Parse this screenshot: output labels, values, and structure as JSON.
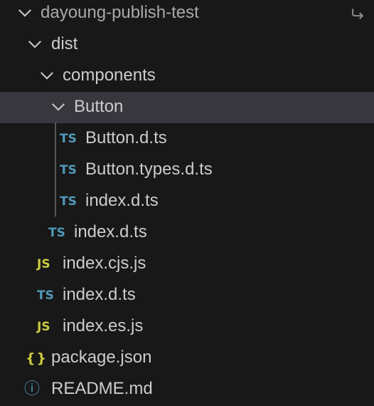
{
  "explorer": {
    "root": {
      "label": "dayoung-publish-test",
      "expanded": true
    },
    "items": [
      {
        "label": "dist",
        "type": "folder",
        "expanded": true
      },
      {
        "label": "components",
        "type": "folder",
        "expanded": true
      },
      {
        "label": "Button",
        "type": "folder",
        "expanded": true,
        "selected": true
      },
      {
        "label": "Button.d.ts",
        "type": "ts",
        "icon": "TS"
      },
      {
        "label": "Button.types.d.ts",
        "type": "ts",
        "icon": "TS"
      },
      {
        "label": "index.d.ts",
        "type": "ts",
        "icon": "TS"
      },
      {
        "label": "index.d.ts",
        "type": "ts",
        "icon": "TS"
      },
      {
        "label": "index.cjs.js",
        "type": "js",
        "icon": "JS"
      },
      {
        "label": "index.d.ts",
        "type": "ts",
        "icon": "TS"
      },
      {
        "label": "index.es.js",
        "type": "js",
        "icon": "JS"
      },
      {
        "label": "package.json",
        "type": "json",
        "icon": "{}"
      },
      {
        "label": "README.md",
        "type": "info",
        "icon": "ⓘ"
      }
    ]
  },
  "colors": {
    "background": "#181818",
    "selected_row": "#37373d",
    "text": "#cccccc",
    "ts_icon": "#519aba",
    "js_icon": "#cbcb41",
    "indent_guide": "#585858"
  }
}
